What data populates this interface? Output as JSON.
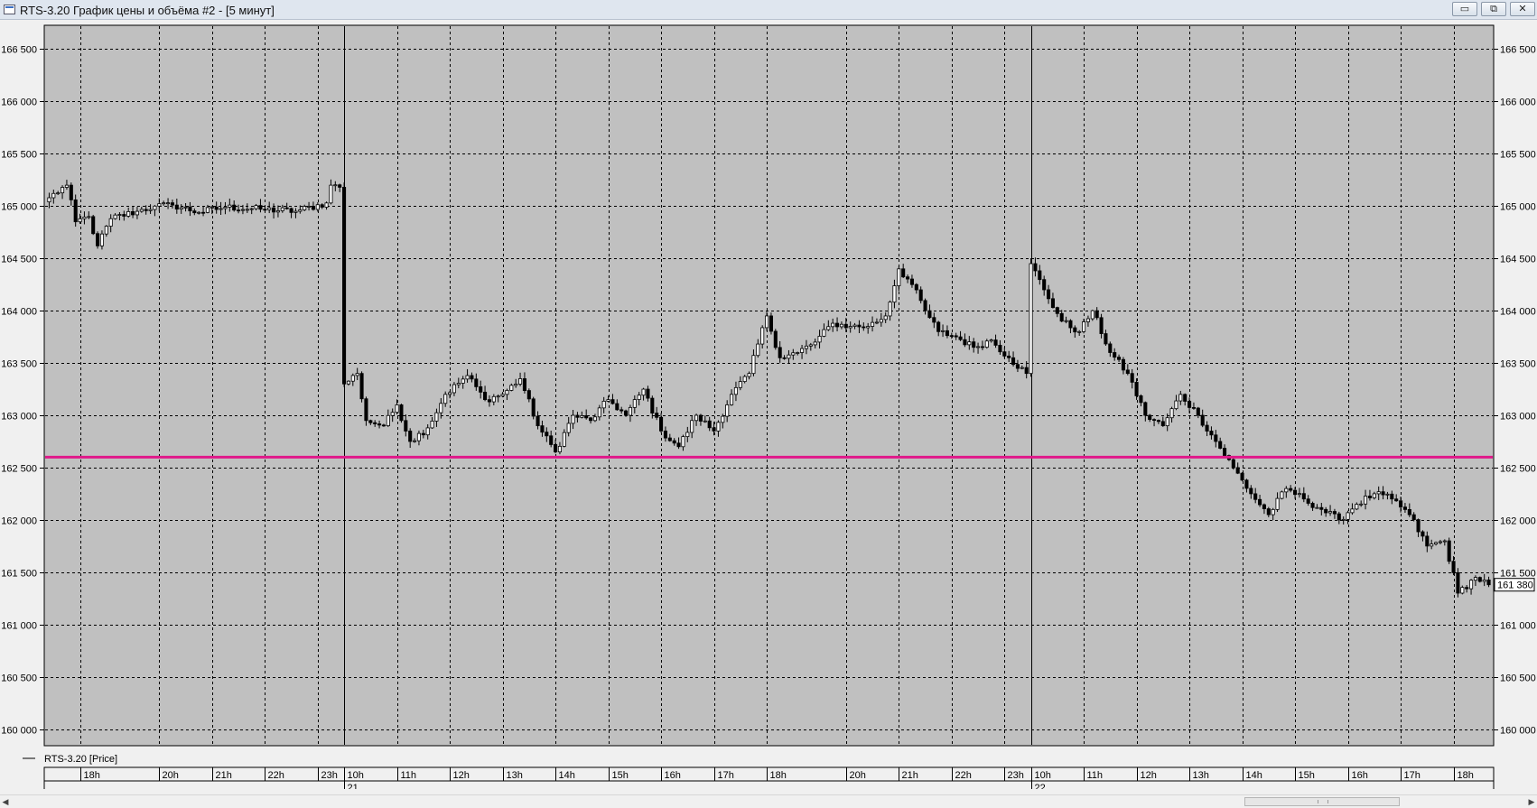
{
  "window": {
    "title": "RTS-3.20 График цены и объёма #2 - [5 минут]",
    "minimize_label": "▭",
    "restore_label": "⧉",
    "close_label": "✕"
  },
  "legend": {
    "label": "RTS-3.20 [Price]"
  },
  "current_price": "161 380",
  "level_line": {
    "value": 162600,
    "color": "#e0188a"
  },
  "colors": {
    "background": "#c0c0c0",
    "candles": "#000000",
    "grid": "#000000"
  },
  "chart_data": {
    "type": "candlestick",
    "interval": "5 минут",
    "ylim": [
      159850,
      166720
    ],
    "y_ticks": [
      {
        "value": 160000,
        "label": "160 000"
      },
      {
        "value": 160500,
        "label": "160 500"
      },
      {
        "value": 161000,
        "label": "161 000"
      },
      {
        "value": 161500,
        "label": "161 500"
      },
      {
        "value": 162000,
        "label": "162 000"
      },
      {
        "value": 162500,
        "label": "162 500"
      },
      {
        "value": 163000,
        "label": "163 000"
      },
      {
        "value": 163500,
        "label": "163 500"
      },
      {
        "value": 164000,
        "label": "164 000"
      },
      {
        "value": 164500,
        "label": "164 500"
      },
      {
        "value": 165000,
        "label": "165 000"
      },
      {
        "value": 165500,
        "label": "165 500"
      },
      {
        "value": 166000,
        "label": "166 000"
      },
      {
        "value": 166500,
        "label": "166 500"
      }
    ],
    "x_hours": [
      {
        "index": 7,
        "label": "18h"
      },
      {
        "index": 25,
        "label": "20h"
      },
      {
        "index": 37,
        "label": "21h"
      },
      {
        "index": 49,
        "label": "22h"
      },
      {
        "index": 61,
        "label": "23h"
      },
      {
        "index": 67,
        "label": "10h"
      },
      {
        "index": 79,
        "label": "11h"
      },
      {
        "index": 91,
        "label": "12h"
      },
      {
        "index": 103,
        "label": "13h"
      },
      {
        "index": 115,
        "label": "14h"
      },
      {
        "index": 127,
        "label": "15h"
      },
      {
        "index": 139,
        "label": "16h"
      },
      {
        "index": 151,
        "label": "17h"
      },
      {
        "index": 163,
        "label": "18h"
      },
      {
        "index": 181,
        "label": "20h"
      },
      {
        "index": 193,
        "label": "21h"
      },
      {
        "index": 205,
        "label": "22h"
      },
      {
        "index": 217,
        "label": "23h"
      },
      {
        "index": 223,
        "label": "10h"
      },
      {
        "index": 235,
        "label": "11h"
      },
      {
        "index": 247,
        "label": "12h"
      },
      {
        "index": 259,
        "label": "13h"
      },
      {
        "index": 271,
        "label": "14h"
      },
      {
        "index": 283,
        "label": "15h"
      },
      {
        "index": 295,
        "label": "16h"
      },
      {
        "index": 307,
        "label": "17h"
      },
      {
        "index": 319,
        "label": "18h"
      }
    ],
    "x_dates": [
      {
        "index": 67,
        "label": "21"
      },
      {
        "index": 223,
        "label": "22"
      }
    ],
    "close_path": [
      [
        0,
        165080
      ],
      [
        4,
        165200
      ],
      [
        6,
        164850
      ],
      [
        9,
        164900
      ],
      [
        11,
        164620
      ],
      [
        14,
        164880
      ],
      [
        20,
        164950
      ],
      [
        24,
        165000
      ],
      [
        28,
        165010
      ],
      [
        34,
        164940
      ],
      [
        40,
        164990
      ],
      [
        48,
        164970
      ],
      [
        56,
        164950
      ],
      [
        63,
        165030
      ],
      [
        64,
        165200
      ],
      [
        66,
        165180
      ],
      [
        67,
        163300
      ],
      [
        70,
        163400
      ],
      [
        72,
        162950
      ],
      [
        76,
        162900
      ],
      [
        79,
        163100
      ],
      [
        82,
        162750
      ],
      [
        86,
        162880
      ],
      [
        90,
        163200
      ],
      [
        95,
        163380
      ],
      [
        99,
        163150
      ],
      [
        103,
        163200
      ],
      [
        107,
        163350
      ],
      [
        111,
        162900
      ],
      [
        115,
        162650
      ],
      [
        119,
        163000
      ],
      [
        123,
        162950
      ],
      [
        127,
        163150
      ],
      [
        131,
        163000
      ],
      [
        135,
        163250
      ],
      [
        139,
        162850
      ],
      [
        143,
        162700
      ],
      [
        147,
        163000
      ],
      [
        151,
        162850
      ],
      [
        155,
        163200
      ],
      [
        159,
        163400
      ],
      [
        163,
        163950
      ],
      [
        166,
        163550
      ],
      [
        170,
        163600
      ],
      [
        174,
        163700
      ],
      [
        178,
        163880
      ],
      [
        182,
        163850
      ],
      [
        186,
        163850
      ],
      [
        190,
        163950
      ],
      [
        193,
        164400
      ],
      [
        196,
        164250
      ],
      [
        199,
        164000
      ],
      [
        202,
        163800
      ],
      [
        206,
        163750
      ],
      [
        210,
        163650
      ],
      [
        214,
        163720
      ],
      [
        218,
        163550
      ],
      [
        222,
        163400
      ],
      [
        223,
        164450
      ],
      [
        226,
        164200
      ],
      [
        230,
        163900
      ],
      [
        234,
        163800
      ],
      [
        237,
        164000
      ],
      [
        241,
        163600
      ],
      [
        245,
        163400
      ],
      [
        249,
        163000
      ],
      [
        253,
        162900
      ],
      [
        257,
        163200
      ],
      [
        261,
        163000
      ],
      [
        265,
        162750
      ],
      [
        269,
        162500
      ],
      [
        273,
        162250
      ],
      [
        277,
        162050
      ],
      [
        281,
        162300
      ],
      [
        285,
        162200
      ],
      [
        289,
        162100
      ],
      [
        293,
        162000
      ],
      [
        297,
        162150
      ],
      [
        301,
        162250
      ],
      [
        305,
        162200
      ],
      [
        309,
        162050
      ],
      [
        313,
        161750
      ],
      [
        317,
        161800
      ],
      [
        320,
        161300
      ],
      [
        324,
        161450
      ],
      [
        327,
        161380
      ]
    ]
  }
}
